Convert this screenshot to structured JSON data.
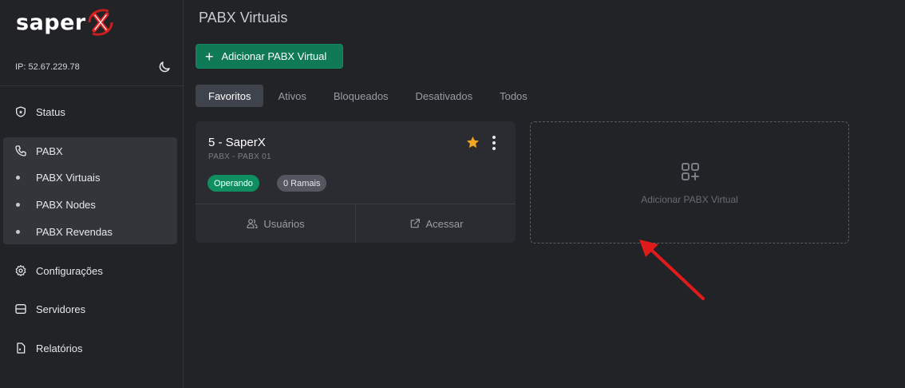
{
  "sidebar": {
    "logo_text": "saper",
    "ip_label": "IP: 52.67.229.78",
    "items": {
      "status": "Status",
      "pabx": "PABX",
      "pabx_virtuais": "PABX Virtuais",
      "pabx_nodes": "PABX Nodes",
      "pabx_revendas": "PABX Revendas",
      "configuracoes": "Configurações",
      "servidores": "Servidores",
      "relatorios": "Relatórios"
    }
  },
  "main": {
    "title": "PABX Virtuais",
    "add_button": "Adicionar PABX Virtual",
    "tabs": [
      "Favoritos",
      "Ativos",
      "Bloqueados",
      "Desativados",
      "Todos"
    ],
    "active_tab": "Favoritos",
    "card": {
      "title": "5 - SaperX",
      "subtitle": "PABX - PABX 01",
      "status_badge": "Operando",
      "extensions_badge": "0 Ramais",
      "users_button": "Usuários",
      "access_button": "Acessar",
      "favorite": true
    },
    "add_card_label": "Adicionar PABX Virtual"
  },
  "colors": {
    "background": "#222327",
    "accent_green": "#0f7a55",
    "star": "#f5a623",
    "arrow": "#e01b1b"
  },
  "icons": [
    "moon-icon",
    "shield-icon",
    "phone-icon",
    "gear-icon",
    "server-icon",
    "report-icon",
    "star-icon",
    "kebab-icon",
    "users-icon",
    "external-link-icon",
    "add-grid-icon"
  ]
}
